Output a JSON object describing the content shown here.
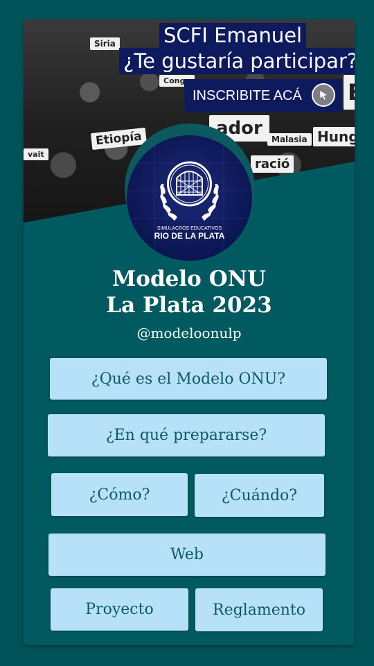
{
  "banner": {
    "title_line1": "SCFI Emanuel",
    "title_line2": "¿Te gustaría participar?",
    "cta_label": "INSCRIBITE ACÁ",
    "cta_icon": "cursor-icon",
    "signs": [
      "Siria",
      "Congo",
      "ador",
      "Etiopía",
      "vait",
      "Malasia",
      "Hung",
      "ració"
    ]
  },
  "logo": {
    "line1": "SIMULACROS EDUCATIVOS",
    "line2": "RIO DE LA PLATA"
  },
  "profile": {
    "name_line1": "Modelo ONU",
    "name_line2": "La Plata 2023",
    "handle": "@modeloonulp"
  },
  "links": {
    "que_es": "¿Qué es el Modelo ONU?",
    "preparar": "¿En qué prepararse?",
    "como": "¿Cómo?",
    "cuando": "¿Cuándo?",
    "web": "Web",
    "proyecto": "Proyecto",
    "reglamento": "Reglamento"
  },
  "colors": {
    "background": "#01535a",
    "button": "#b7e1f8",
    "button_text": "#0e5a62",
    "banner_label": "#0d1a5e"
  }
}
